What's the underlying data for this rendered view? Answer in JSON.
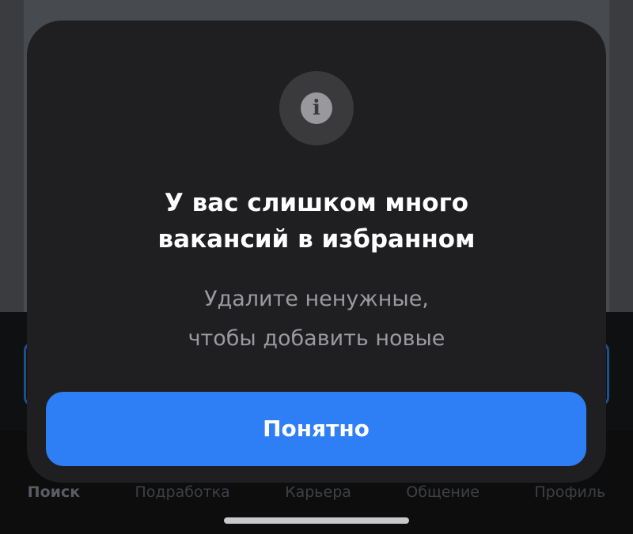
{
  "modal": {
    "title_line1": "У вас слишком много",
    "title_line2": "вакансий в избранном",
    "subtitle_line1": "Удалите ненужные,",
    "subtitle_line2": "чтобы добавить новые",
    "icon": "info-icon",
    "icon_glyph": "i",
    "button_label": "Понятно"
  },
  "tabbar": {
    "items": [
      {
        "label": "Поиск"
      },
      {
        "label": "Подработка"
      },
      {
        "label": "Карьера"
      },
      {
        "label": "Общение"
      },
      {
        "label": "Профиль"
      }
    ]
  },
  "colors": {
    "accent": "#2e7ff5",
    "sheet_background": "#1f1f21"
  }
}
